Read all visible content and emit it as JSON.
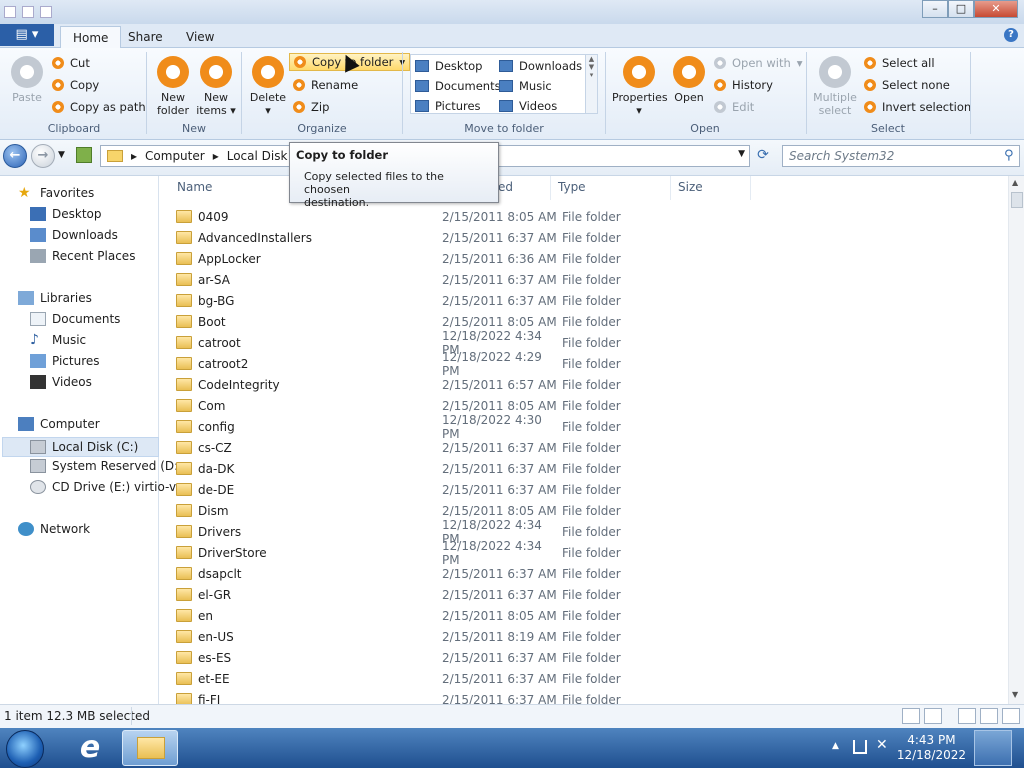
{
  "ribbon_tabs": {
    "home": "Home",
    "share": "Share",
    "view": "View"
  },
  "clipboard": {
    "paste": "Paste",
    "cut": "Cut",
    "copy": "Copy",
    "copy_as_path": "Copy as path",
    "label": "Clipboard"
  },
  "new": {
    "new_folder_1": "New",
    "new_folder_2": "folder",
    "new_items_1": "New",
    "new_items_2": "items",
    "label": "New"
  },
  "organize": {
    "delete": "Delete",
    "copy_to_folder": "Copy to folder",
    "rename": "Rename",
    "zip": "Zip",
    "label": "Organize"
  },
  "move_to": {
    "items": [
      "Desktop",
      "Documents",
      "Pictures",
      "Downloads",
      "Music",
      "Videos"
    ],
    "label": "Move to folder"
  },
  "open": {
    "properties": "Properties",
    "open": "Open",
    "open_with": "Open with",
    "history": "History",
    "edit": "Edit",
    "label": "Open"
  },
  "select": {
    "multiple_1": "Multiple",
    "multiple_2": "select",
    "select_all": "Select all",
    "select_none": "Select none",
    "invert": "Invert selection",
    "label": "Select"
  },
  "address": {
    "computer": "Computer",
    "local_disk": "Local Disk (C:"
  },
  "search": {
    "placeholder": "Search System32"
  },
  "tooltip": {
    "title": "Copy to folder",
    "desc1": "Copy selected files to the choosen",
    "desc2": "destination."
  },
  "nav": {
    "favorites": "Favorites",
    "desktop": "Desktop",
    "downloads": "Downloads",
    "recent": "Recent Places",
    "libraries": "Libraries",
    "documents": "Documents",
    "music": "Music",
    "pictures": "Pictures",
    "videos": "Videos",
    "computer": "Computer",
    "local_disk": "Local Disk (C:)",
    "system_reserved": "System Reserved (D:",
    "cd_drive": "CD Drive (E:) virtio-v",
    "network": "Network"
  },
  "columns": {
    "name": "Name",
    "date": "ed",
    "type": "Type",
    "size": "Size"
  },
  "files": [
    {
      "name": "0409",
      "date": "2/15/2011 8:05 AM",
      "type": "File folder"
    },
    {
      "name": "AdvancedInstallers",
      "date": "2/15/2011 6:37 AM",
      "type": "File folder"
    },
    {
      "name": "AppLocker",
      "date": "2/15/2011 6:36 AM",
      "type": "File folder"
    },
    {
      "name": "ar-SA",
      "date": "2/15/2011 6:37 AM",
      "type": "File folder"
    },
    {
      "name": "bg-BG",
      "date": "2/15/2011 6:37 AM",
      "type": "File folder"
    },
    {
      "name": "Boot",
      "date": "2/15/2011 8:05 AM",
      "type": "File folder"
    },
    {
      "name": "catroot",
      "date": "12/18/2022 4:34 PM",
      "type": "File folder"
    },
    {
      "name": "catroot2",
      "date": "12/18/2022 4:29 PM",
      "type": "File folder"
    },
    {
      "name": "CodeIntegrity",
      "date": "2/15/2011 6:57 AM",
      "type": "File folder"
    },
    {
      "name": "Com",
      "date": "2/15/2011 8:05 AM",
      "type": "File folder"
    },
    {
      "name": "config",
      "date": "12/18/2022 4:30 PM",
      "type": "File folder"
    },
    {
      "name": "cs-CZ",
      "date": "2/15/2011 6:37 AM",
      "type": "File folder"
    },
    {
      "name": "da-DK",
      "date": "2/15/2011 6:37 AM",
      "type": "File folder"
    },
    {
      "name": "de-DE",
      "date": "2/15/2011 6:37 AM",
      "type": "File folder"
    },
    {
      "name": "Dism",
      "date": "2/15/2011 8:05 AM",
      "type": "File folder"
    },
    {
      "name": "Drivers",
      "date": "12/18/2022 4:34 PM",
      "type": "File folder"
    },
    {
      "name": "DriverStore",
      "date": "12/18/2022 4:34 PM",
      "type": "File folder"
    },
    {
      "name": "dsapclt",
      "date": "2/15/2011 6:37 AM",
      "type": "File folder"
    },
    {
      "name": "el-GR",
      "date": "2/15/2011 6:37 AM",
      "type": "File folder"
    },
    {
      "name": "en",
      "date": "2/15/2011 8:05 AM",
      "type": "File folder"
    },
    {
      "name": "en-US",
      "date": "2/15/2011 8:19 AM",
      "type": "File folder"
    },
    {
      "name": "es-ES",
      "date": "2/15/2011 6:37 AM",
      "type": "File folder"
    },
    {
      "name": "et-EE",
      "date": "2/15/2011 6:37 AM",
      "type": "File folder"
    },
    {
      "name": "fi-FI",
      "date": "2/15/2011 6:37 AM",
      "type": "File folder"
    }
  ],
  "status": {
    "text": "1 item 12.3 MB selected"
  },
  "clock": {
    "time": "4:43 PM",
    "date": "12/18/2022"
  }
}
